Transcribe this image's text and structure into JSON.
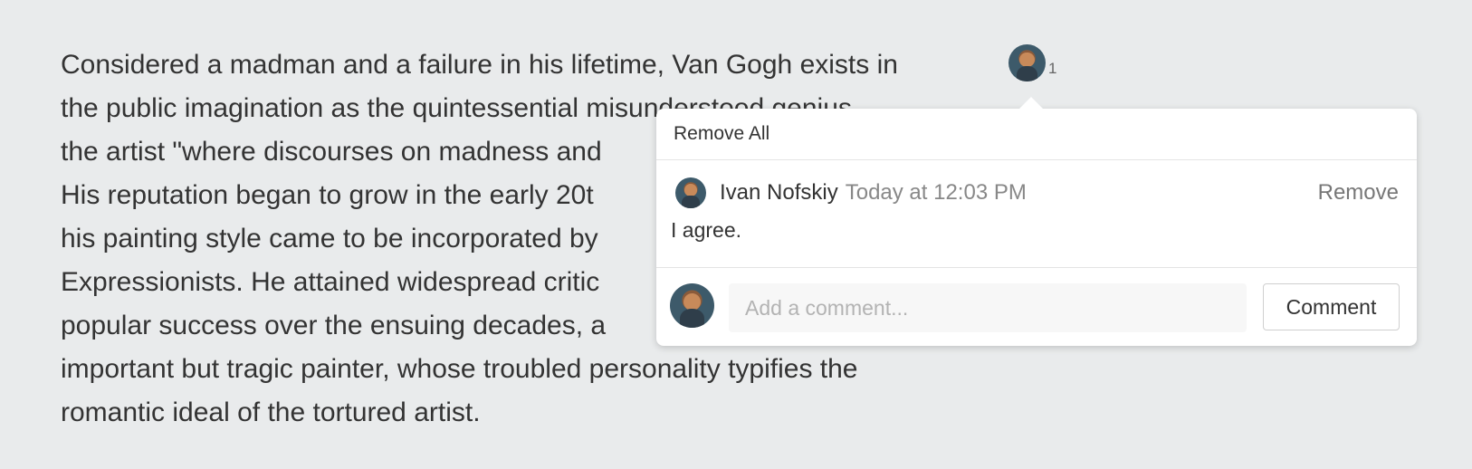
{
  "article": {
    "lines": [
      "Considered a madman and a failure in his lifetime, Van Gogh exists in",
      "the public imagination as the quintessential misunderstood genius,",
      "the artist \"where discourses on madness and",
      "His reputation began to grow in the early 20t",
      "his painting style came to be incorporated by",
      "Expressionists. He attained widespread critic",
      "popular success over the ensuing decades, a",
      "important but tragic painter, whose troubled personality typifies the",
      "romantic ideal of the tortured artist."
    ]
  },
  "comment_indicator": {
    "count": "1",
    "avatar_icon": "van-gogh-avatar"
  },
  "popover": {
    "remove_all_label": "Remove All",
    "comments": [
      {
        "author": "Ivan Nofskiy",
        "timestamp": "Today at 12:03 PM",
        "remove_label": "Remove",
        "text": "I agree."
      }
    ],
    "compose": {
      "placeholder": "Add a comment...",
      "value": "",
      "submit_label": "Comment"
    }
  },
  "colors": {
    "page_background": "#e9ebec",
    "text": "#333333",
    "muted_text": "#888888",
    "popover_background": "#ffffff"
  }
}
